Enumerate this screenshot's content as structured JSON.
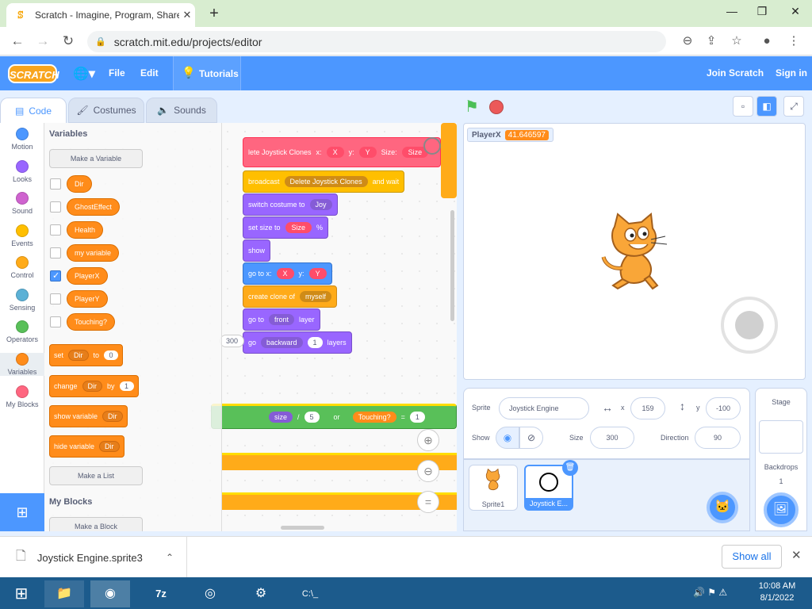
{
  "browser": {
    "tab_title": "Scratch - Imagine, Program, Share",
    "url": "scratch.mit.edu/projects/editor"
  },
  "menubar": {
    "logo": "SCRATCH",
    "file": "File",
    "edit": "Edit",
    "tutorials": "Tutorials",
    "join": "Join Scratch",
    "signin": "Sign in"
  },
  "tabs": {
    "code": "Code",
    "costumes": "Costumes",
    "sounds": "Sounds"
  },
  "categories": [
    {
      "label": "Motion",
      "color": "#4c97ff"
    },
    {
      "label": "Looks",
      "color": "#9966ff"
    },
    {
      "label": "Sound",
      "color": "#cf63cf"
    },
    {
      "label": "Events",
      "color": "#ffbf00"
    },
    {
      "label": "Control",
      "color": "#ffab19"
    },
    {
      "label": "Sensing",
      "color": "#5cb1d6"
    },
    {
      "label": "Operators",
      "color": "#59c059"
    },
    {
      "label": "Variables",
      "color": "#ff8c1a"
    },
    {
      "label": "My Blocks",
      "color": "#ff6680"
    }
  ],
  "flyout": {
    "variables_heading": "Variables",
    "make_variable": "Make a Variable",
    "variables": [
      {
        "name": "Dir",
        "checked": false
      },
      {
        "name": "GhostEffect",
        "checked": false
      },
      {
        "name": "Health",
        "checked": false
      },
      {
        "name": "my variable",
        "checked": false
      },
      {
        "name": "PlayerX",
        "checked": true
      },
      {
        "name": "PlayerY",
        "checked": false
      },
      {
        "name": "Touching?",
        "checked": false
      }
    ],
    "set_block": {
      "label": "set",
      "var": "Dir",
      "to": "to",
      "value": "0"
    },
    "change_block": {
      "label": "change",
      "var": "Dir",
      "by": "by",
      "value": "1"
    },
    "show_block": {
      "label": "show variable",
      "var": "Dir"
    },
    "hide_block": {
      "label": "hide variable",
      "var": "Dir"
    },
    "make_list": "Make a List",
    "myblocks_heading": "My Blocks",
    "make_block": "Make a Block"
  },
  "workspace": {
    "top_block": {
      "text": "lete Joystick Clones",
      "x": "x:",
      "xv": "X",
      "y": "y:",
      "yv": "Y",
      "size": "Size:",
      "sizev": "Size"
    },
    "broadcast": {
      "label": "broadcast",
      "msg": "Delete Joystick Clones",
      "tail": "and wait"
    },
    "switch_costume": {
      "label": "switch costume to",
      "val": "Joy"
    },
    "set_size": {
      "label": "set size to",
      "val": "Size",
      "unit": "%"
    },
    "show": "show",
    "goto": {
      "label": "go to x:",
      "x": "X",
      "y": "y:",
      "yv": "Y"
    },
    "clone": {
      "label": "create clone of",
      "val": "myself"
    },
    "goto_front": {
      "label": "go to",
      "val": "front",
      "tail": "layer"
    },
    "go_back": {
      "label": "go",
      "val": "backward",
      "num": "1",
      "tail": "layers"
    },
    "num300": "300",
    "cond": {
      "size": "size",
      "slash": "/",
      "five": "5",
      "or": "or",
      "touching": "Touching?",
      "eq": "=",
      "one": "1"
    }
  },
  "stage": {
    "monitor_label": "PlayerX",
    "monitor_value": "41.646597"
  },
  "sprite_info": {
    "sprite_label": "Sprite",
    "sprite_name": "Joystick Engine",
    "x_label": "x",
    "x": "159",
    "y_label": "y",
    "y": "-100",
    "show_label": "Show",
    "size_label": "Size",
    "size": "300",
    "direction_label": "Direction",
    "direction": "90"
  },
  "sprites": [
    {
      "name": "Sprite1",
      "selected": false
    },
    {
      "name": "Joystick E...",
      "selected": true
    }
  ],
  "stage_pane": {
    "label": "Stage",
    "backdrops_label": "Backdrops",
    "backdrops_count": "1"
  },
  "download": {
    "filename": "Joystick Engine.sprite3",
    "show_all": "Show all"
  },
  "taskbar": {
    "time": "10:08 AM",
    "date": "8/1/2022"
  }
}
